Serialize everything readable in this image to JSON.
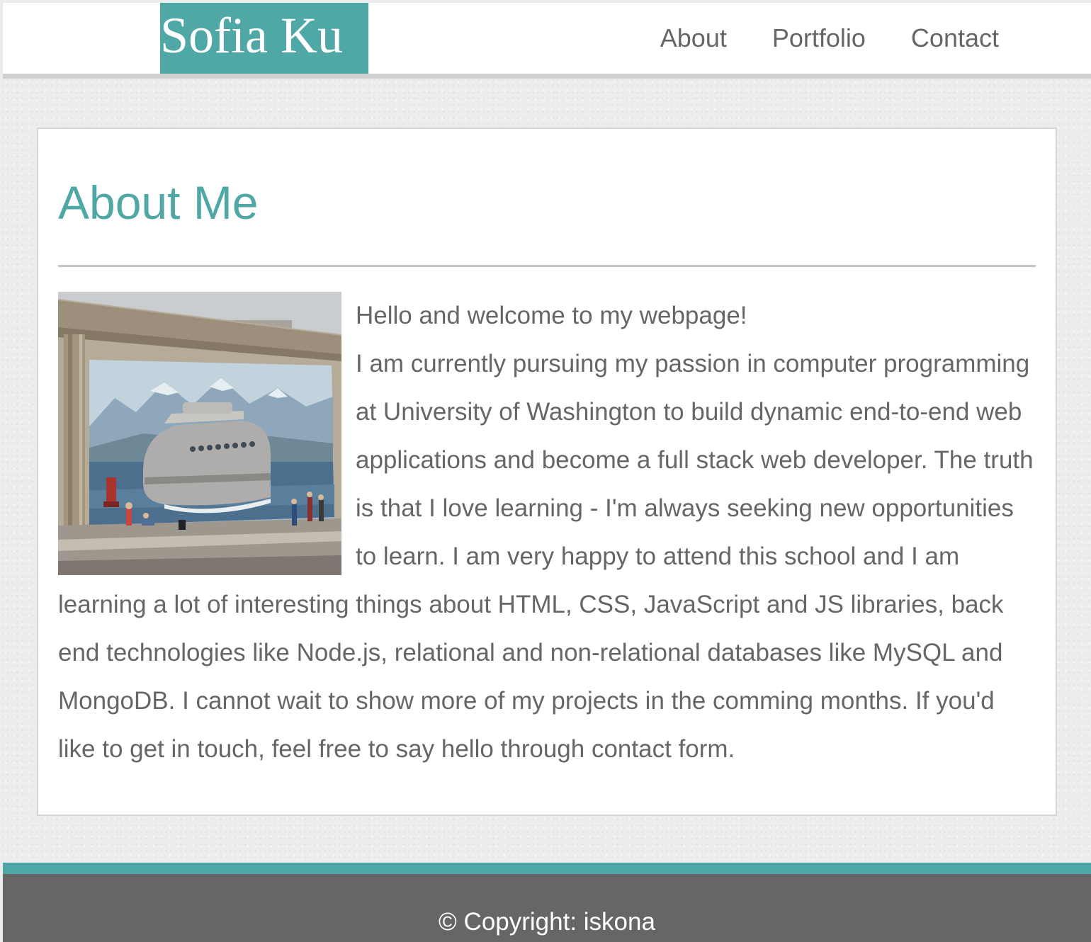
{
  "header": {
    "brand": "Sofia Ku",
    "nav": [
      "About",
      "Portfolio",
      "Contact"
    ]
  },
  "main": {
    "title": "About Me",
    "image_alt": "Mural of a streamlined ferry on a wall with mountains behind",
    "greeting": "Hello and welcome to my webpage!",
    "body": "I am currently pursuing my passion in computer programming at University of Washington to build dynamic end-to-end web applications and become a full stack web developer. The truth is that I love learning - I'm always seeking new opportunities to learn. I am very happy to attend this school and I am learning a lot of interesting things about HTML, CSS, JavaScript and JS libraries, back end technologies like Node.js, relational and non-relational databases like MySQL and MongoDB. I cannot wait to show more of my projects in the comming months. If you'd like to get in touch, feel free to say hello through contact form."
  },
  "footer": {
    "copyright": "© Copyright: iskona"
  },
  "colors": {
    "accent": "#4fa8a5",
    "text": "#666666",
    "footer_bg": "#666666",
    "page_bg": "#ededed"
  }
}
